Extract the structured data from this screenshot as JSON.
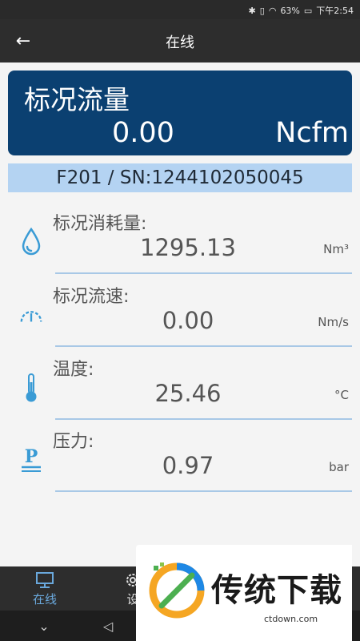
{
  "status": {
    "battery": "63%",
    "time": "下午2:54"
  },
  "appbar": {
    "title": "在线"
  },
  "flow": {
    "label": "标况流量",
    "value": "0.00",
    "unit": "Ncfm"
  },
  "device": {
    "serial": "F201 / SN:1244102050045"
  },
  "readings": [
    {
      "icon": "water-drop-icon",
      "label": "标况消耗量:",
      "value": "1295.13",
      "unit": "Nm³"
    },
    {
      "icon": "speedometer-icon",
      "label": "标况流速:",
      "value": "0.00",
      "unit": "Nm/s"
    },
    {
      "icon": "thermometer-icon",
      "label": "温度:",
      "value": "25.46",
      "unit": "°C"
    },
    {
      "icon": "pressure-icon",
      "label": "压力:",
      "value": "0.97",
      "unit": "bar"
    }
  ],
  "bottom_nav": {
    "online_label": "在线",
    "settings_label": "设"
  },
  "watermark": {
    "brand": "传统下载",
    "domain": "ctdown.com"
  },
  "colors": {
    "card": "#0b4071",
    "serial_bar": "#b4d3f2",
    "accent": "#3a9bd5",
    "tab_active": "#6aa8dc"
  }
}
